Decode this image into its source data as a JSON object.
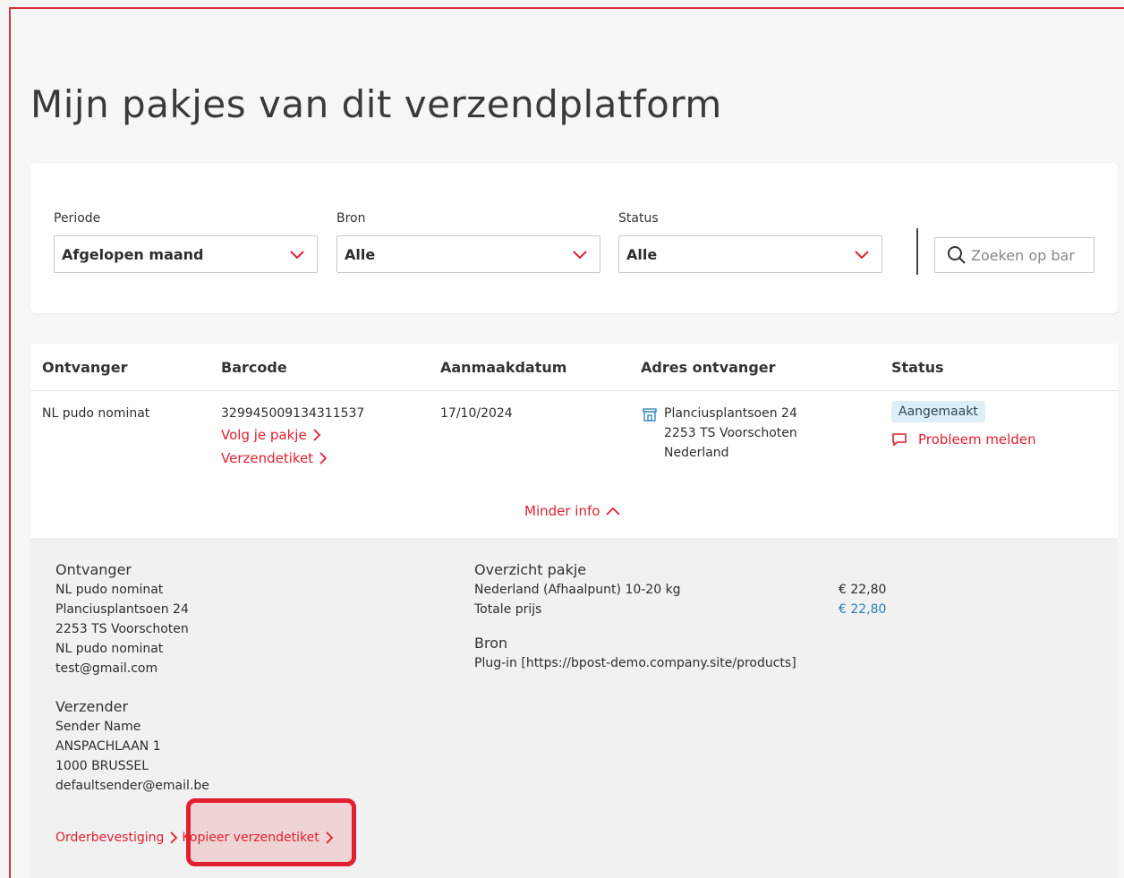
{
  "page": {
    "title": "Mijn pakjes van dit verzendplatform"
  },
  "filters": {
    "period": {
      "label": "Periode",
      "value": "Afgelopen maand"
    },
    "source": {
      "label": "Bron",
      "value": "Alle"
    },
    "status": {
      "label": "Status",
      "value": "Alle"
    },
    "search_placeholder": "Zoeken op bar"
  },
  "table": {
    "headers": [
      "Ontvanger",
      "Barcode",
      "Aanmaakdatum",
      "Adres ontvanger",
      "Status"
    ],
    "row": {
      "recipient": "NL pudo nominat",
      "barcode": "329945009134311537",
      "track_link": "Volg je pakje",
      "label_link": "Verzendetiket",
      "created": "17/10/2024",
      "address": [
        "Planciusplantsoen 24",
        "2253 TS Voorschoten",
        "Nederland"
      ],
      "status_badge": "Aangemaakt",
      "report_problem": "Probleem melden"
    },
    "less_info": "Minder info"
  },
  "details": {
    "recipient": {
      "title": "Ontvanger",
      "lines": [
        "NL pudo nominat",
        "Planciusplantsoen 24",
        "2253 TS Voorschoten",
        "NL pudo nominat",
        "test@gmail.com"
      ]
    },
    "sender": {
      "title": "Verzender",
      "lines": [
        "Sender Name",
        "ANSPACHLAAN 1",
        "1000 BRUSSEL",
        "defaultsender@email.be"
      ]
    },
    "overview": {
      "title": "Overzicht pakje",
      "item_label": "Nederland (Afhaalpunt) 10-20 kg",
      "item_price": "€ 22,80",
      "total_label": "Totale prijs",
      "total_price": "€ 22,80"
    },
    "source": {
      "title": "Bron",
      "value": "Plug-in [https://bpost-demo.company.site/products]"
    },
    "actions": {
      "order_confirmation": "Orderbevestiging",
      "copy_label": "Kopieer verzendetiket"
    }
  },
  "colors": {
    "accent": "#e0202f",
    "badge_bg": "#dceff6",
    "price_blue": "#2a7db5"
  }
}
